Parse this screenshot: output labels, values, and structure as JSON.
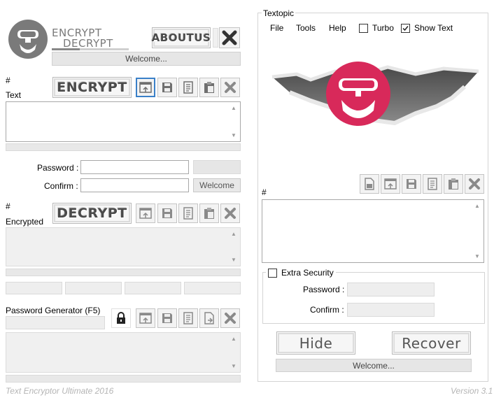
{
  "logo": {
    "line1": "ENCRYPT",
    "line2": "DECRYPT"
  },
  "about_label": "ABOUTUS",
  "welcome_top": "Welcome...",
  "encrypt_section": {
    "hash": "#",
    "text_label": "Text",
    "button": "ENCRYPT"
  },
  "password_label": "Password :",
  "confirm_label": "Confirm :",
  "welcome_btn": "Welcome",
  "decrypt_section": {
    "hash": "#",
    "label": "Encrypted",
    "button": "DECRYPT"
  },
  "generator_label": "Password Generator (F5)",
  "footer_left": "Text Encryptor Ultimate 2016",
  "footer_right": "Version 3.1",
  "textopic": {
    "title": "Textopic",
    "menu": [
      "File",
      "Tools",
      "Help"
    ],
    "turbo_label": "Turbo",
    "turbo_checked": false,
    "show_text_label": "Show Text",
    "show_text_checked": true,
    "hash": "#",
    "extra_security_label": "Extra Security",
    "extra_security_checked": false,
    "password_label": "Password :",
    "confirm_label": "Confirm :",
    "hide_label": "Hide",
    "recover_label": "Recover",
    "welcome_status": "Welcome..."
  },
  "colors": {
    "accent": "#d8295a",
    "selection": "#3a80c8",
    "icon_gray": "#6f6f6f"
  }
}
